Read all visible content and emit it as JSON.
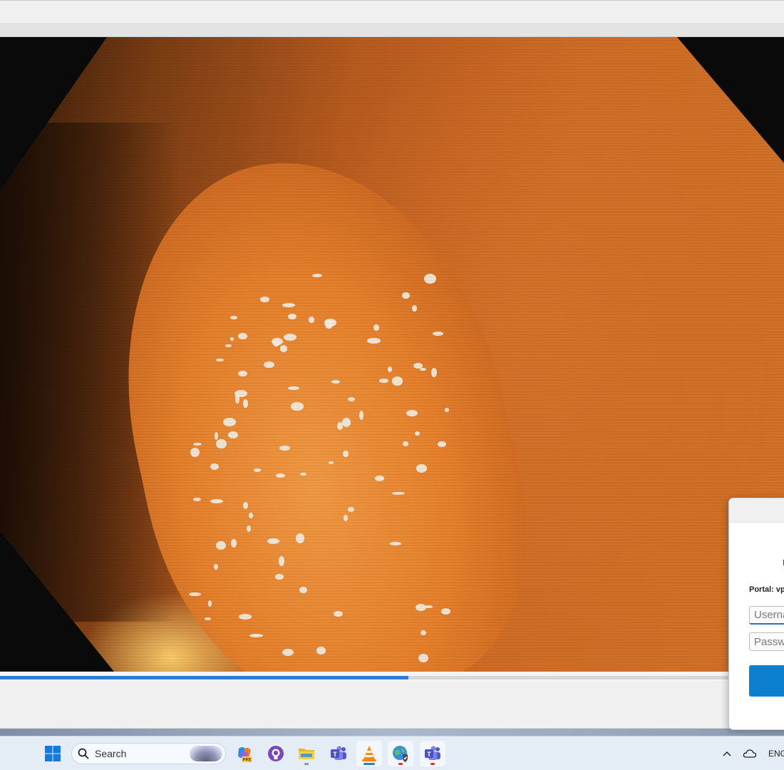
{
  "player": {
    "progress_fraction": 0.521
  },
  "login_dialog": {
    "portal_label": "Portal: vp",
    "username_placeholder": "Username",
    "password_placeholder": "Password",
    "submit_label": ""
  },
  "taskbar": {
    "search_placeholder": "Search",
    "pinned_apps": [
      "Copilot (PRE)",
      "GitHub Desktop",
      "File Explorer",
      "Microsoft Teams",
      "VLC media player",
      "Browser",
      "Microsoft Teams (work)"
    ],
    "tray_language": "ENG"
  },
  "colors": {
    "accent": "#2f7bd6",
    "button_blue": "#0c7fce"
  }
}
